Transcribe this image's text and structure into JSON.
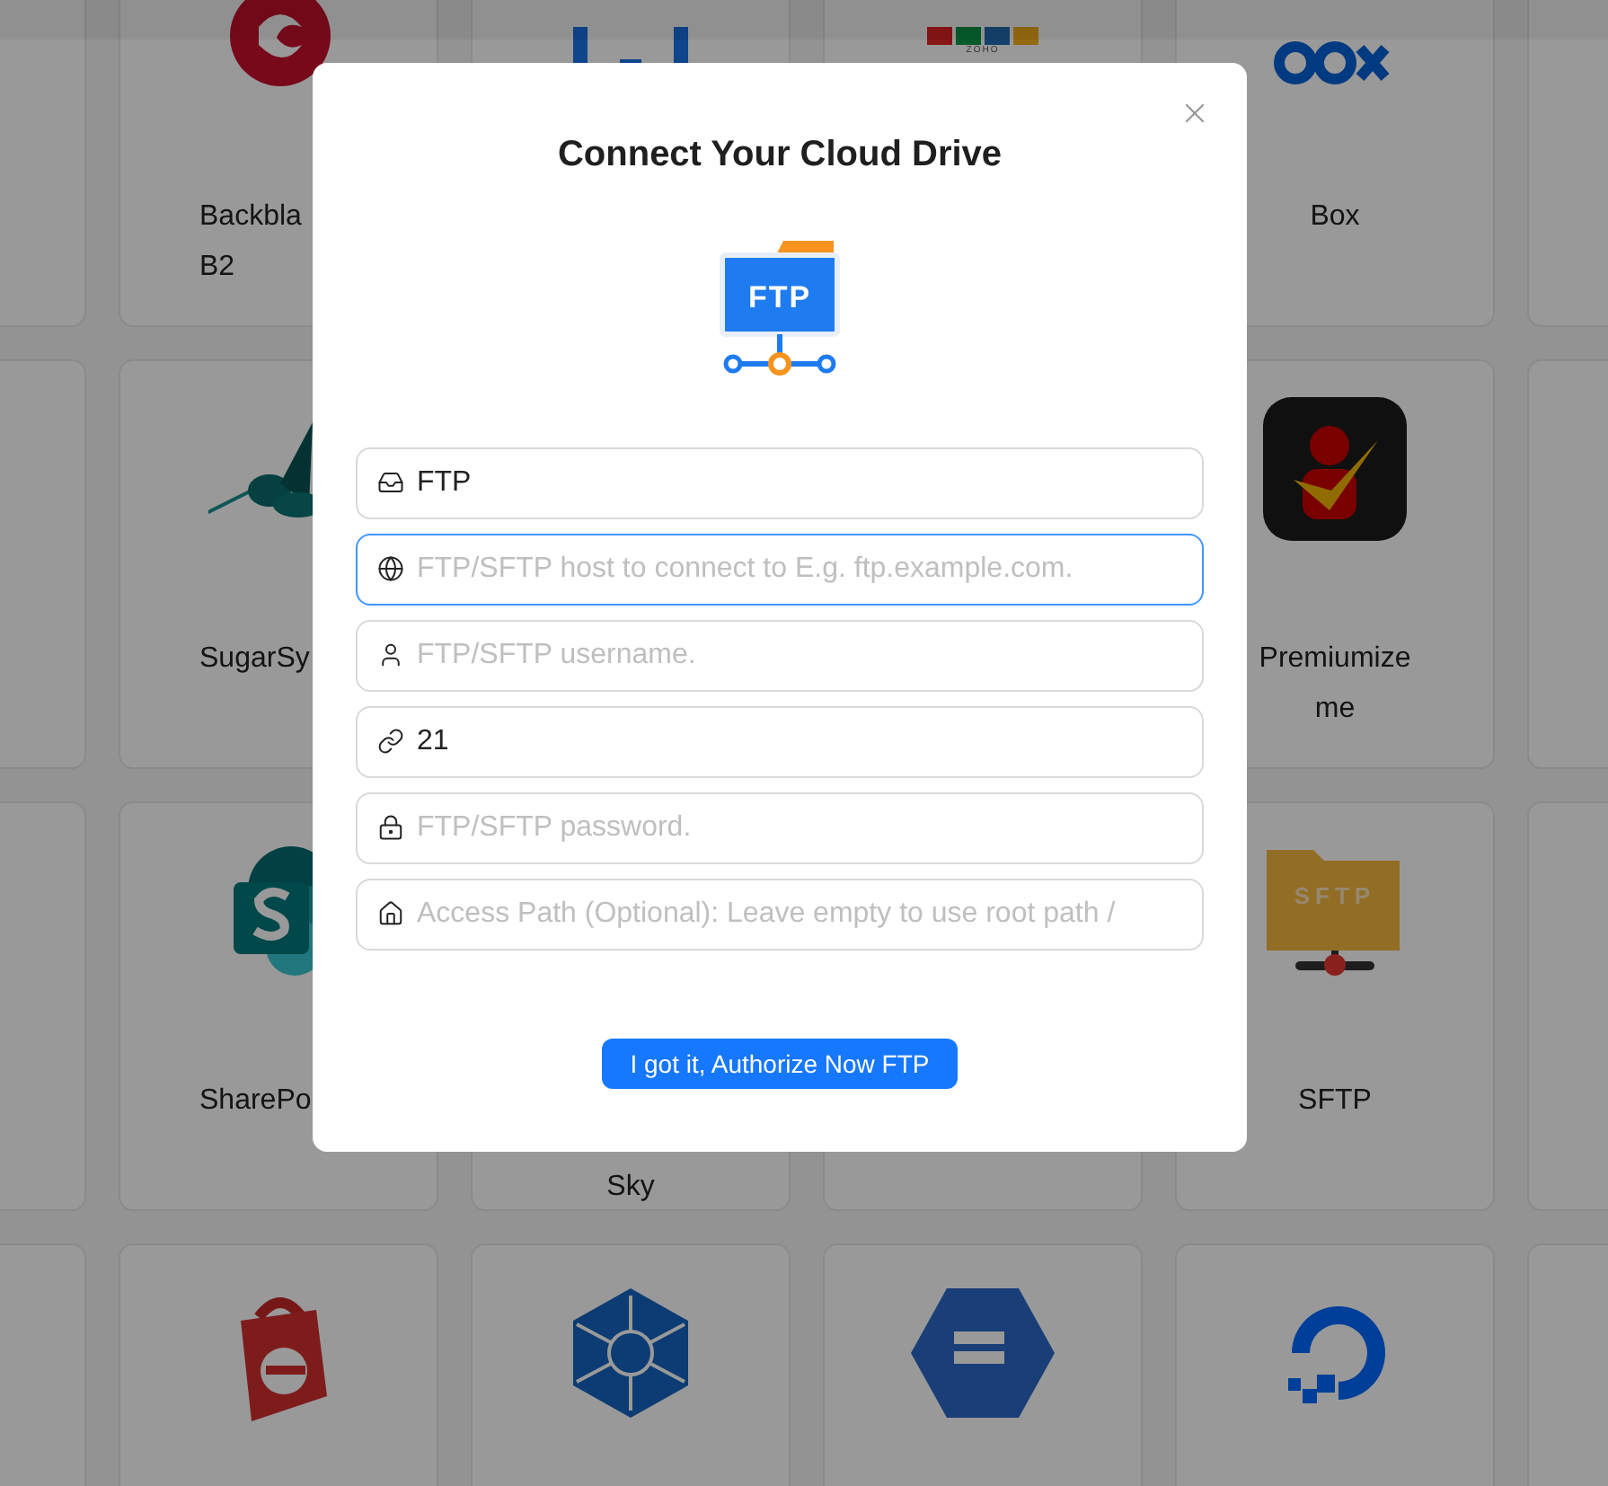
{
  "service_grid": [
    [
      {
        "kind": "blank"
      },
      {
        "kind": "circle",
        "label": [
          "Backbla",
          "B2"
        ]
      },
      {
        "kind": "bracket"
      },
      {
        "kind": "blocks",
        "logo_text": "ZOHO"
      },
      {
        "kind": "wordmark",
        "label": [
          "Box"
        ]
      },
      {
        "kind": "blank"
      }
    ],
    [
      {
        "kind": "blank"
      },
      {
        "kind": "bird",
        "label": [
          "SugarSy"
        ]
      },
      {
        "kind": "covered"
      },
      {
        "kind": "covered"
      },
      {
        "kind": "person",
        "label": [
          "Premiumize",
          "me"
        ]
      },
      {
        "kind": "blank"
      }
    ],
    [
      {
        "kind": "blank"
      },
      {
        "kind": "tile",
        "label": [
          "SharePo"
        ]
      },
      {
        "kind": "blank",
        "label": [
          "Sky"
        ]
      },
      {
        "kind": "blank"
      },
      {
        "kind": "folder",
        "label": [
          "SFTP"
        ],
        "logo_text": "SFTP"
      },
      {
        "kind": "blank"
      }
    ],
    [
      {
        "kind": "blank"
      },
      {
        "kind": "bag"
      },
      {
        "kind": "network"
      },
      {
        "kind": "hexagon"
      },
      {
        "kind": "ring"
      },
      {
        "kind": "blank"
      }
    ]
  ],
  "dialog": {
    "title": "Connect Your Cloud Drive",
    "logo_text": "FTP",
    "fields": [
      {
        "value": "FTP",
        "focused": false
      },
      {
        "placeholder": "FTP/SFTP host to connect to E.g. ftp.example.com.",
        "focused": true
      },
      {
        "placeholder": "FTP/SFTP username.",
        "focused": false
      },
      {
        "value": "21",
        "focused": false
      },
      {
        "placeholder": "FTP/SFTP password.",
        "focused": false
      },
      {
        "placeholder": "Access Path (Optional): Leave empty to use root path /",
        "focused": false
      }
    ],
    "button": "I got it, Authorize Now FTP"
  }
}
